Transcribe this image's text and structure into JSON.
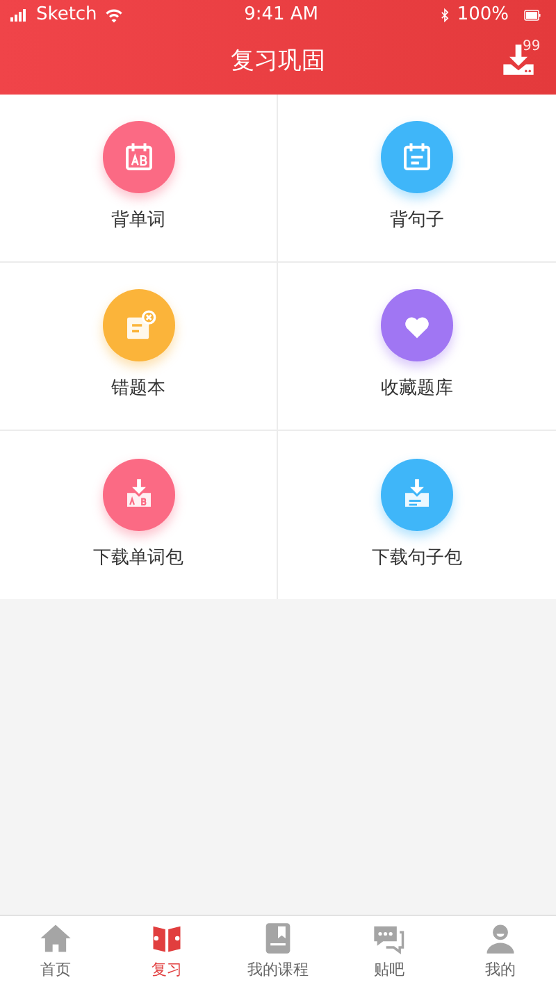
{
  "status_bar": {
    "carrier": "Sketch",
    "time": "9:41 AM",
    "battery": "100%"
  },
  "header": {
    "title": "复习巩固",
    "download_badge": "99"
  },
  "tiles": [
    {
      "label": "背单词",
      "kind": "words",
      "color": "#fb6a84"
    },
    {
      "label": "背句子",
      "kind": "sentences",
      "color": "#3fb6f9"
    },
    {
      "label": "错题本",
      "kind": "mistakes",
      "color": "#fbb43a"
    },
    {
      "label": "收藏题库",
      "kind": "favorites",
      "color": "#a076f3"
    },
    {
      "label": "下载单词包",
      "kind": "download-words",
      "color": "#fb6a84"
    },
    {
      "label": "下载句子包",
      "kind": "download-sentences",
      "color": "#3fb6f9"
    }
  ],
  "tab_bar": [
    {
      "label": "首页",
      "kind": "home",
      "selected": false
    },
    {
      "label": "复习",
      "kind": "review",
      "selected": true
    },
    {
      "label": "我的课程",
      "kind": "courses",
      "selected": false
    },
    {
      "label": "贴吧",
      "kind": "forum",
      "selected": false
    },
    {
      "label": "我的",
      "kind": "me",
      "selected": false
    }
  ]
}
